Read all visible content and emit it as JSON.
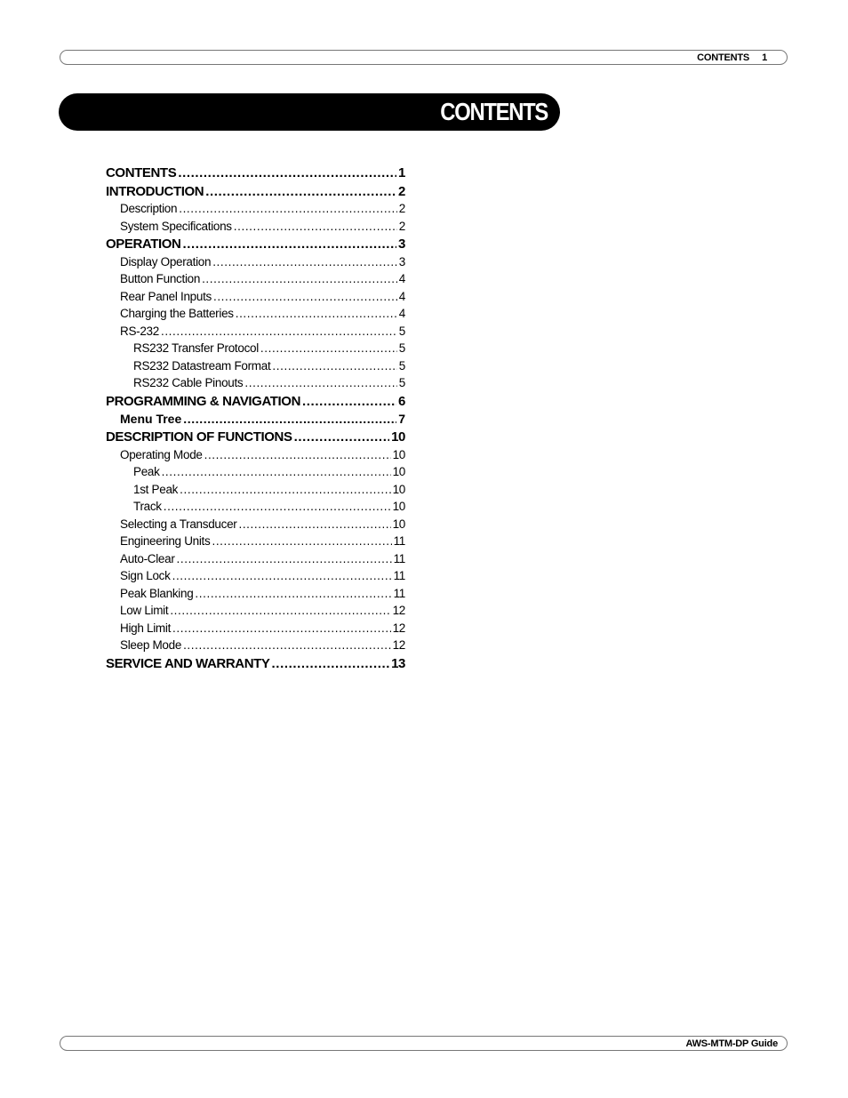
{
  "header": {
    "section": "CONTENTS",
    "page_number": "1"
  },
  "banner": {
    "title": "CONTENTS"
  },
  "toc": [
    {
      "label": "CONTENTS",
      "page": "1",
      "level": "lvl1"
    },
    {
      "label": "INTRODUCTION",
      "page": "2",
      "level": "lvl1"
    },
    {
      "label": "Description",
      "page": "2",
      "level": "lvl2"
    },
    {
      "label": "System Specifications",
      "page": "2",
      "level": "lvl2"
    },
    {
      "label": "OPERATION",
      "page": "3",
      "level": "lvl1"
    },
    {
      "label": "Display Operation",
      "page": "3",
      "level": "lvl2"
    },
    {
      "label": "Button Function",
      "page": "4",
      "level": "lvl2"
    },
    {
      "label": "Rear Panel Inputs",
      "page": "4",
      "level": "lvl2"
    },
    {
      "label": "Charging the Batteries",
      "page": "4",
      "level": "lvl2"
    },
    {
      "label": "RS-232",
      "page": "5",
      "level": "lvl2"
    },
    {
      "label": "RS232 Transfer Protocol",
      "page": "5",
      "level": "lvl3"
    },
    {
      "label": "RS232 Datastream Format",
      "page": "5",
      "level": "lvl3"
    },
    {
      "label": "RS232 Cable Pinouts",
      "page": "5",
      "level": "lvl3"
    },
    {
      "label": "PROGRAMMING & NAVIGATION",
      "page": "6",
      "level": "lvl1"
    },
    {
      "label": "Menu Tree",
      "page": "7",
      "level": "lvl2b"
    },
    {
      "label": "DESCRIPTION OF FUNCTIONS",
      "page": "10",
      "level": "lvl1"
    },
    {
      "label": "Operating Mode",
      "page": "10",
      "level": "lvl2"
    },
    {
      "label": "Peak",
      "page": "10",
      "level": "lvl3"
    },
    {
      "label": "1st Peak",
      "page": "10",
      "level": "lvl3"
    },
    {
      "label": "Track",
      "page": "10",
      "level": "lvl3"
    },
    {
      "label": "Selecting a Transducer",
      "page": "10",
      "level": "lvl2"
    },
    {
      "label": "Engineering Units",
      "page": "11",
      "level": "lvl2"
    },
    {
      "label": "Auto-Clear",
      "page": "11",
      "level": "lvl2"
    },
    {
      "label": "Sign Lock",
      "page": "11",
      "level": "lvl2"
    },
    {
      "label": "Peak Blanking",
      "page": "11",
      "level": "lvl2"
    },
    {
      "label": "Low Limit",
      "page": "12",
      "level": "lvl2"
    },
    {
      "label": "High Limit",
      "page": "12",
      "level": "lvl2"
    },
    {
      "label": "Sleep Mode",
      "page": "12",
      "level": "lvl2"
    },
    {
      "label": "SERVICE AND WARRANTY",
      "page": "13",
      "level": "lvl1"
    }
  ],
  "footer": {
    "guide_title": "AWS-MTM-DP Guide"
  }
}
